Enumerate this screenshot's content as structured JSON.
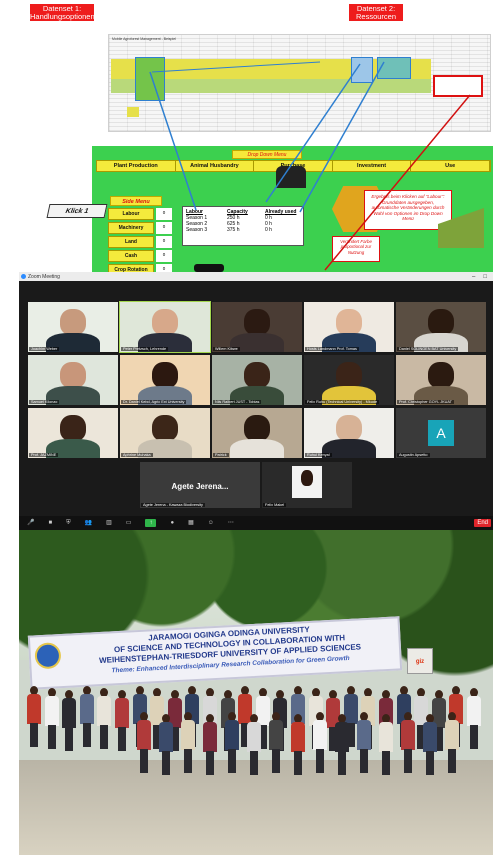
{
  "diagram": {
    "dataset1_label": "Datenset 1: Handlungsoptionen",
    "dataset2_label": "Datenset 2: Ressourcen",
    "sheet_title": "Mobile Agroforest Management - Beispiel",
    "drop_down_label": "Drop Down Menu",
    "top_menu": [
      "Plant Production",
      "Animal Husbandry",
      "Purchase",
      "Investment",
      "Use"
    ],
    "side_menu_label": "Side Menu",
    "klick_label": "Klick 1",
    "side_menu": [
      {
        "label": "Labour",
        "value": "0"
      },
      {
        "label": "Machinery",
        "value": "0"
      },
      {
        "label": "Land",
        "value": "0"
      },
      {
        "label": "Cash",
        "value": "0"
      },
      {
        "label": "Crop Rotation",
        "value": "0"
      }
    ],
    "table": {
      "col1_header": "Labour",
      "col1_rows": [
        "Season 1",
        "Season 2",
        "Season 3"
      ],
      "col2_header": "Capacity",
      "col2_rows": [
        "250 h",
        "625 h",
        "375 h"
      ],
      "col3_header": "Already used",
      "col3_rows": [
        "0 h",
        "0 h",
        "0 h"
      ]
    },
    "note_red": "Ergebnis beim Klicken auf \"Labour\": Grunddaten ausgegeben, automatische Veränderungen durch Wahl von Optionen im Drop Down Menü",
    "note_bottom": "Verändert Farbe proportional zur Nutzung",
    "colors": {
      "dataset_red": "#ee1c1c",
      "app_green": "#3cd04f",
      "menu_yellow": "#f4ea3c",
      "arrow_blue": "#2f7fd0",
      "arrow_red": "#d11111"
    }
  },
  "zoom": {
    "window_title": "Zoom Meeting",
    "participants": [
      {
        "name": "Joachim Weber"
      },
      {
        "name": "Peter Pretzsch, Lehrende"
      },
      {
        "name": "Willem Kibwe"
      },
      {
        "name": "Hosts Landmann Prof. Tomas"
      },
      {
        "name": "Daniel SOLINGEN BAT University"
      },
      {
        "name": "Samuel Kilonzo"
      },
      {
        "name": "Dr. Daniel Kebd, Agric Ext University"
      },
      {
        "name": "Nils Raibert JUST - Tobias"
      },
      {
        "name": "Felix Ruhu (Technical University) - Mkude"
      },
      {
        "name": "Prof. Christopher GOYL JKUAT"
      },
      {
        "name": "Prof. JAZMINE"
      },
      {
        "name": "Aphrine Muhaka"
      },
      {
        "name": "Patrick"
      },
      {
        "name": "Ruhul Kenyal"
      },
      {
        "name": "Augustin Apsetto"
      }
    ],
    "bottom_participants": [
      {
        "name": "Agete Jerena - Kawaza Biodiversity",
        "big_name": "Agete Jerena..."
      },
      {
        "name": "Felix Makel"
      }
    ],
    "avatar_letter": "A",
    "toolbar": {
      "items": [
        "Mute",
        "Stop Video",
        "Security",
        "Participants",
        "Polls",
        "Chat",
        "Share Screen",
        "Record",
        "Breakout Rooms",
        "Reactions",
        "More"
      ],
      "end_label": "End"
    }
  },
  "photo": {
    "banner_lines": [
      "JARAMOGI OGINGA ODINGA UNIVERSITY",
      "OF SCIENCE AND TECHNOLOGY IN COLLABORATION WITH",
      "WEIHENSTEPHAN-TRIESDORF UNIVERSITY OF APPLIED SCIENCES",
      "Theme: Enhanced Interdisciplinary Research Collaboration for Green Growth"
    ],
    "banner_right_tag": "giz"
  }
}
